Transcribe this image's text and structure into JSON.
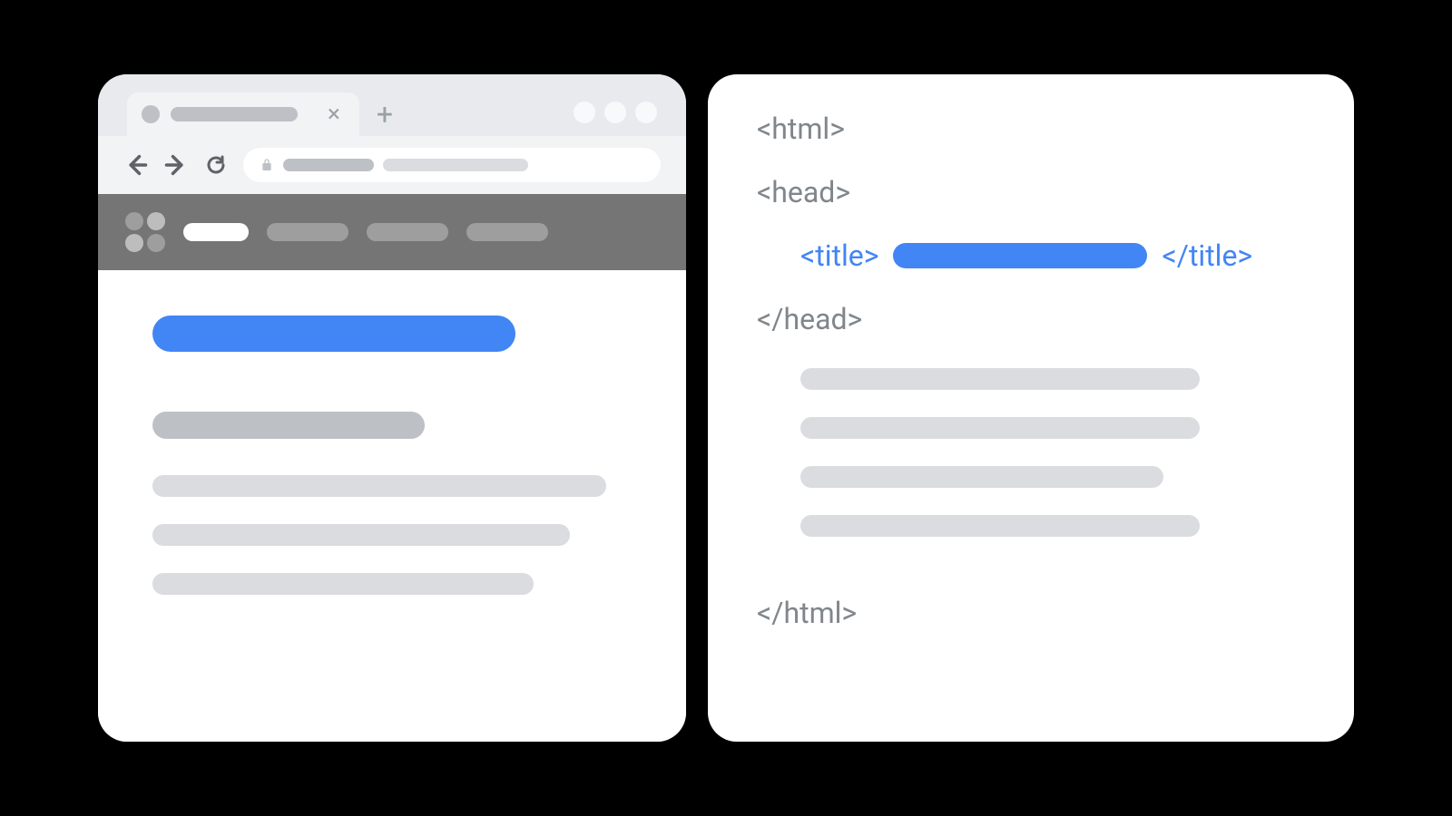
{
  "diagram": {
    "kind": "browser-and-html-source-illustration",
    "highlight_color": "#4285f4"
  },
  "browser": {
    "tab_close_glyph": "×",
    "tab_add_glyph": "+"
  },
  "code": {
    "tags": {
      "html_open": "<html>",
      "head_open": "<head>",
      "title_open": "<title>",
      "title_close": "</title>",
      "head_close": "</head>",
      "html_close": "</html>"
    }
  }
}
